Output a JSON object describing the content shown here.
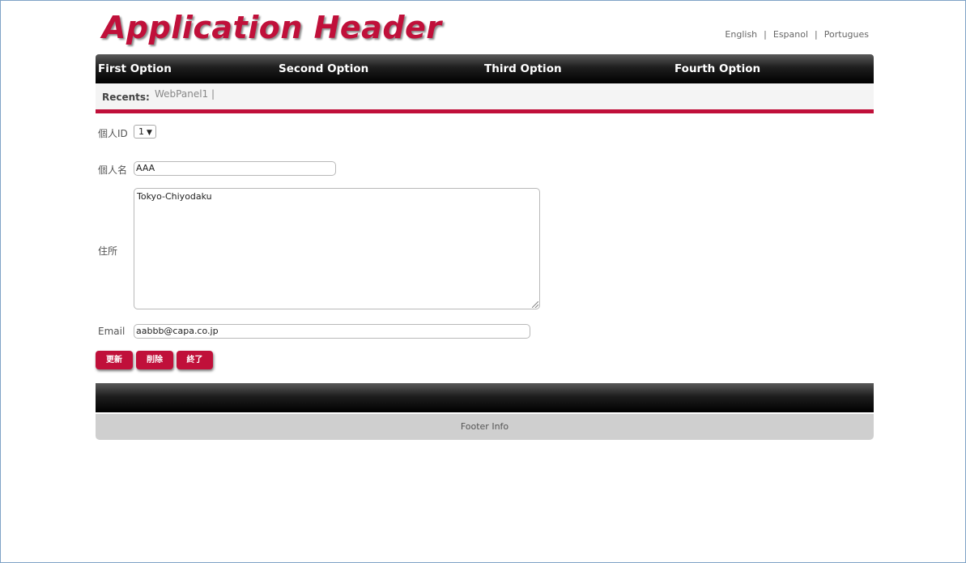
{
  "header": {
    "title": "Application Header",
    "languages": [
      "English",
      "Espanol",
      "Portugues"
    ],
    "separator": "|"
  },
  "menu": {
    "items": [
      "First Option",
      "Second Option",
      "Third Option",
      "Fourth Option"
    ]
  },
  "recents": {
    "label": "Recents:",
    "items": [
      "WebPanel1"
    ],
    "separator": "|"
  },
  "form": {
    "id_label": "個人ID",
    "id_value": "1",
    "name_label": "個人名",
    "name_value": "AAA",
    "address_label": "住所",
    "address_value": "Tokyo-Chiyodaku",
    "email_label": "Email",
    "email_value": "aabbb@capa.co.jp"
  },
  "buttons": {
    "update": "更新",
    "delete": "削除",
    "exit": "終了"
  },
  "footer": {
    "info": "Footer Info"
  },
  "colors": {
    "accent": "#c0103a",
    "menubar": "#000000",
    "footer_info_bg": "#cfcfcf"
  }
}
